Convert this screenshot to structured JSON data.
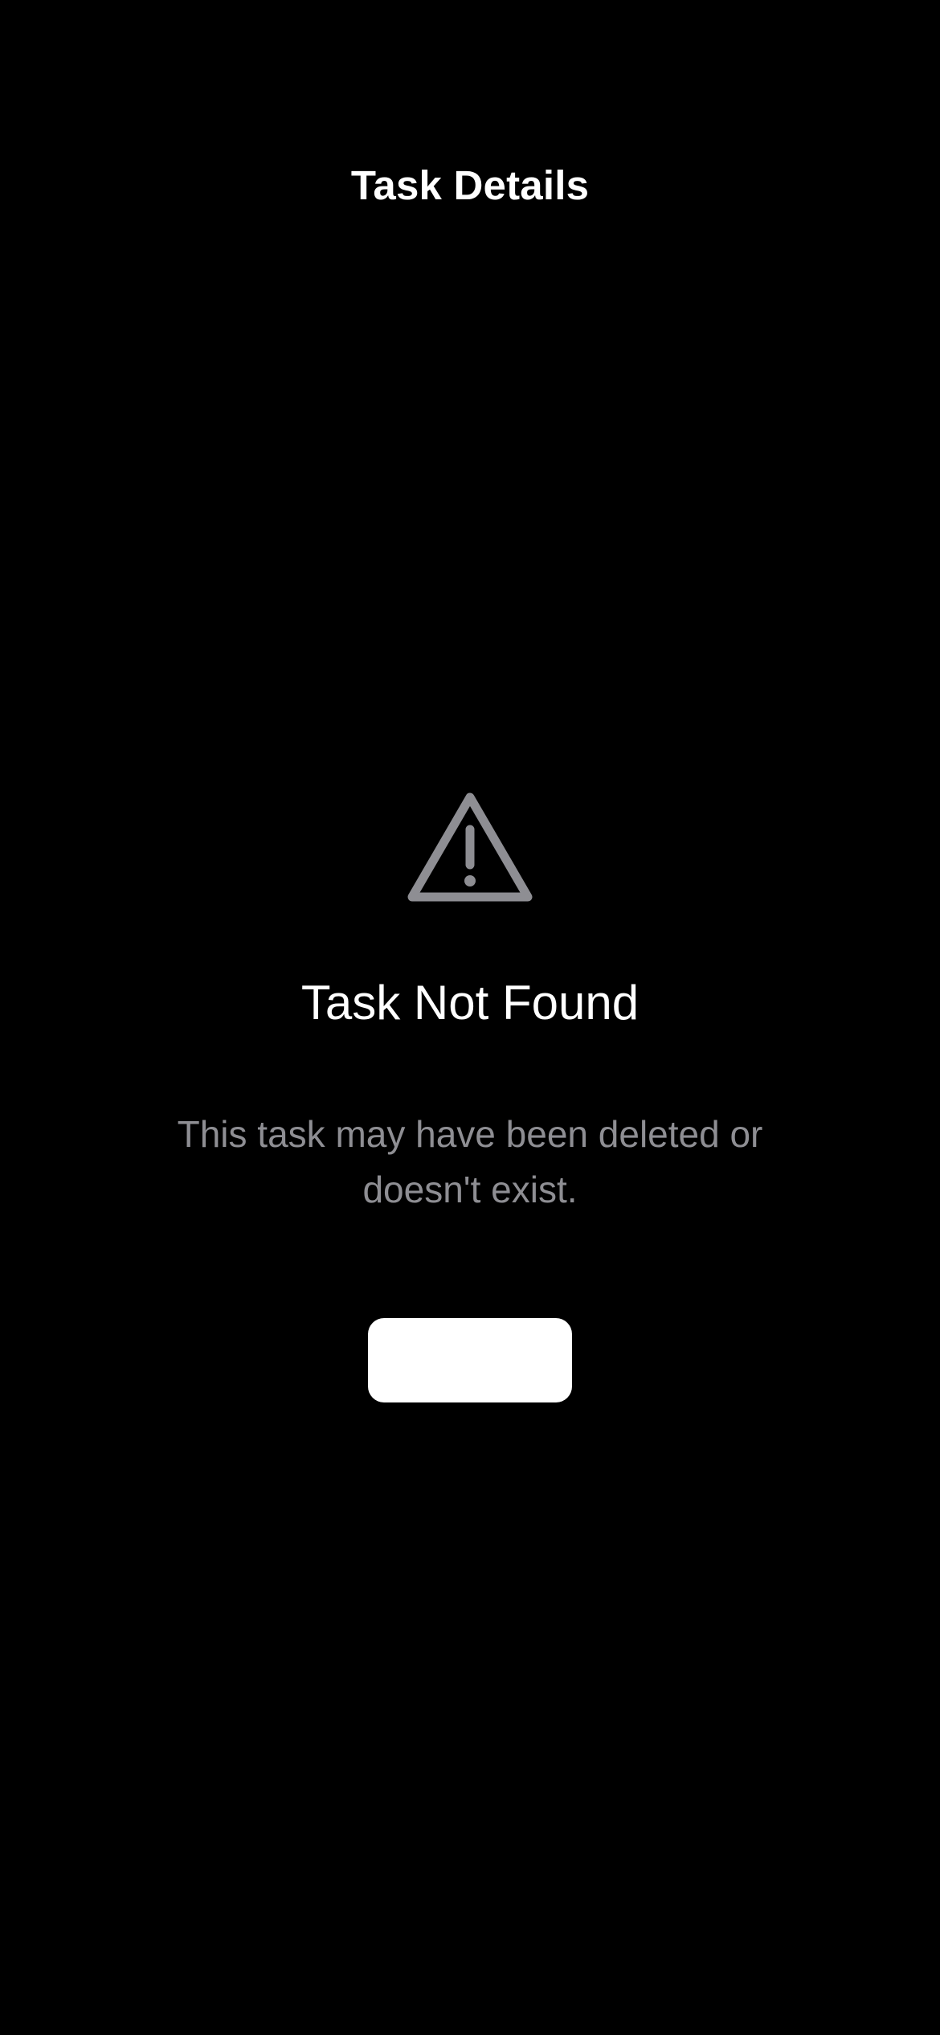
{
  "nav": {
    "title": "Task Details"
  },
  "empty_state": {
    "icon": "warning-triangle-icon",
    "title": "Task Not Found",
    "message": "This task may have been deleted or doesn't exist."
  },
  "action_button": {
    "label": ""
  },
  "colors": {
    "background": "#000000",
    "title_text": "#ffffff",
    "secondary_text": "#8e8e93",
    "icon": "#8e8e93",
    "button_background": "#ffffff"
  }
}
